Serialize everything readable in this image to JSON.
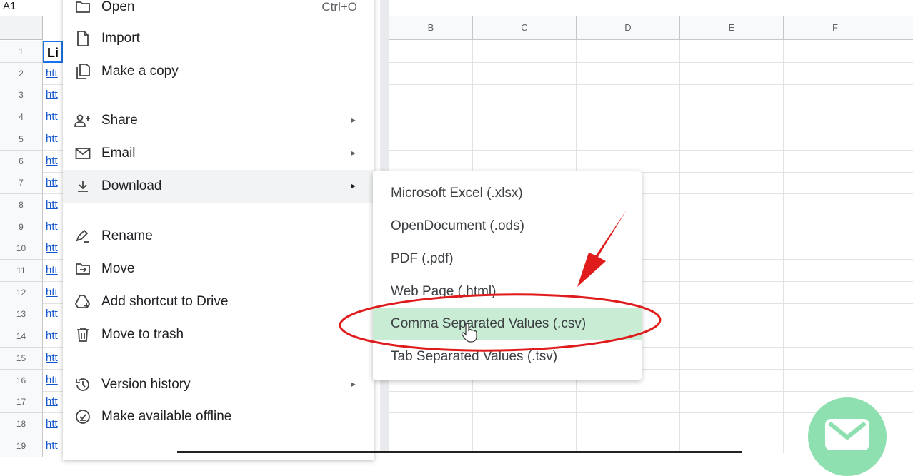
{
  "sheet": {
    "name_box": "A1",
    "columns": [
      "B",
      "C",
      "D",
      "E",
      "F"
    ],
    "rows": [
      "1",
      "2",
      "3",
      "4",
      "5",
      "6",
      "7",
      "8",
      "9",
      "10",
      "11",
      "12",
      "13",
      "14",
      "15",
      "16",
      "17",
      "18",
      "19"
    ],
    "col_a": [
      "Li",
      "htt",
      "htt",
      "htt",
      "htt",
      "htt",
      "htt",
      "htt",
      "htt",
      "htt",
      "htt",
      "htt",
      "htt",
      "htt",
      "htt",
      "htt",
      "htt",
      "htt",
      "htt"
    ]
  },
  "file_menu": {
    "items": [
      {
        "label": "Open",
        "shortcut": "Ctrl+O",
        "icon": "folder-icon"
      },
      {
        "label": "Import",
        "icon": "file-icon"
      },
      {
        "label": "Make a copy",
        "icon": "copy-icon"
      },
      {
        "label": "Share",
        "icon": "share-person-icon",
        "submenu": true
      },
      {
        "label": "Email",
        "icon": "mail-icon",
        "submenu": true
      },
      {
        "label": "Download",
        "icon": "download-icon",
        "submenu": true,
        "active": true
      },
      {
        "label": "Rename",
        "icon": "rename-pencil-icon"
      },
      {
        "label": "Move",
        "icon": "move-folder-icon"
      },
      {
        "label": "Add shortcut to Drive",
        "icon": "drive-shortcut-icon"
      },
      {
        "label": "Move to trash",
        "icon": "trash-icon"
      },
      {
        "label": "Version history",
        "icon": "history-icon",
        "submenu": true
      },
      {
        "label": "Make available offline",
        "icon": "offline-check-icon"
      }
    ]
  },
  "download_submenu": {
    "items": [
      {
        "label": "Microsoft Excel (.xlsx)"
      },
      {
        "label": "OpenDocument (.ods)"
      },
      {
        "label": "PDF (.pdf)"
      },
      {
        "label": "Web Page (.html)"
      },
      {
        "label": "Comma Separated Values (.csv)",
        "highlighted": true
      },
      {
        "label": "Tab Separated Values (.tsv)"
      }
    ]
  },
  "colors": {
    "highlight": "#c8ecd4",
    "annotation_red": "#e01b1b",
    "link_blue": "#1155cc",
    "selection_blue": "#1a73e8",
    "fab_green": "#8fe0b0"
  }
}
